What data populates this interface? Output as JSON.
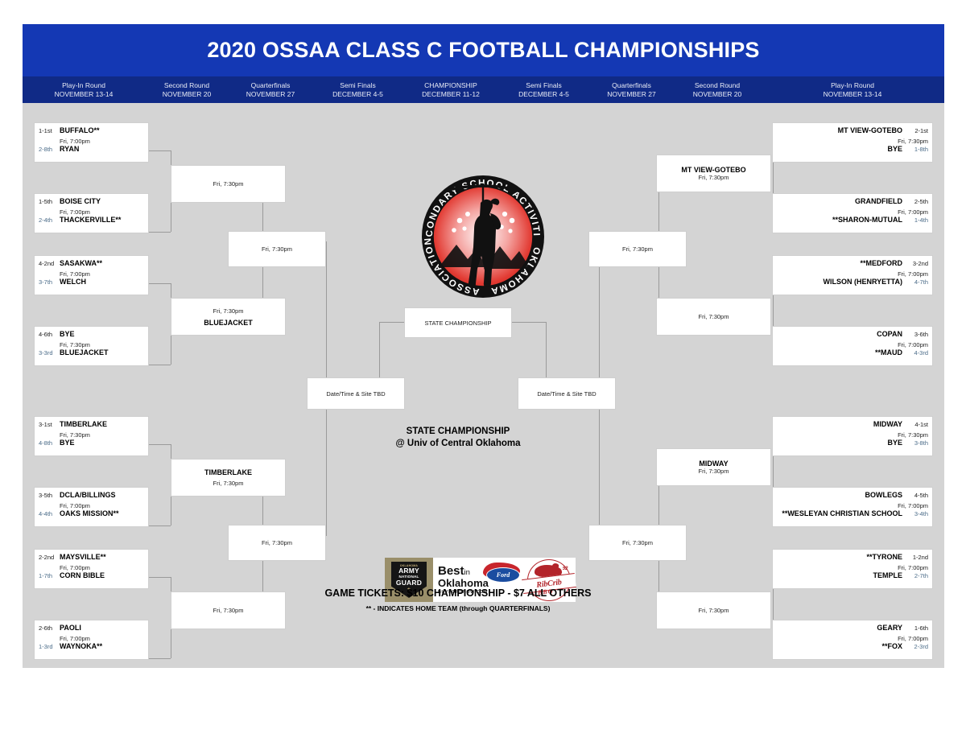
{
  "title": "2020 OSSAA CLASS C FOOTBALL CHAMPIONSHIPS",
  "colors": {
    "title_bar": "#1438b4",
    "round_bar": "#102a86",
    "panel_bg": "#d4d4d4",
    "box_bg": "#ffffff",
    "line": "#9a9a9a",
    "seed_text": "#4a6b88"
  },
  "rounds": [
    {
      "name": "Play-In Round",
      "dates": "NOVEMBER 13-14"
    },
    {
      "name": "Second Round",
      "dates": "NOVEMBER 20"
    },
    {
      "name": "Quarterfinals",
      "dates": "NOVEMBER 27"
    },
    {
      "name": "Semi Finals",
      "dates": "DECEMBER 4-5"
    },
    {
      "name": "CHAMPIONSHIP",
      "dates": "DECEMBER 11-12"
    },
    {
      "name": "Semi Finals",
      "dates": "DECEMBER 4-5"
    },
    {
      "name": "Quarterfinals",
      "dates": "NOVEMBER 27"
    },
    {
      "name": "Second Round",
      "dates": "NOVEMBER 20"
    },
    {
      "name": "Play-In Round",
      "dates": "NOVEMBER 13-14"
    }
  ],
  "left": {
    "playin": [
      {
        "seed_top": "1-1st",
        "team_top": "BUFFALO**",
        "time": "Fri, 7:00pm",
        "seed_bot": "2-8th",
        "team_bot": "RYAN"
      },
      {
        "seed_top": "1-5th",
        "team_top": "BOISE CITY",
        "time": "Fri, 7:00pm",
        "seed_bot": "2-4th",
        "team_bot": "THACKERVILLE**"
      },
      {
        "seed_top": "4-2nd",
        "team_top": "SASAKWA**",
        "time": "Fri, 7:00pm",
        "seed_bot": "3-7th",
        "team_bot": "WELCH"
      },
      {
        "seed_top": "4-6th",
        "team_top": "BYE",
        "time": "Fri, 7:30pm",
        "seed_bot": "3-3rd",
        "team_bot": "BLUEJACKET"
      },
      {
        "seed_top": "3-1st",
        "team_top": "TIMBERLAKE",
        "time": "Fri, 7:30pm",
        "seed_bot": "4-8th",
        "team_bot": "BYE"
      },
      {
        "seed_top": "3-5th",
        "team_top": "DCLA/BILLINGS",
        "time": "Fri, 7:00pm",
        "seed_bot": "4-4th",
        "team_bot": "OAKS MISSION**"
      },
      {
        "seed_top": "2-2nd",
        "team_top": "MAYSVILLE**",
        "time": "Fri, 7:00pm",
        "seed_bot": "1-7th",
        "team_bot": "CORN BIBLE"
      },
      {
        "seed_top": "2-6th",
        "team_top": "PAOLI",
        "time": "Fri, 7:00pm",
        "seed_bot": "1-3rd",
        "team_bot": "WAYNOKA**"
      }
    ],
    "second_round": [
      {
        "team": "",
        "time": "Fri, 7:30pm"
      },
      {
        "team": "BLUEJACKET",
        "time": "Fri, 7:30pm"
      },
      {
        "team": "TIMBERLAKE",
        "time": "Fri, 7:30pm"
      },
      {
        "team": "",
        "time": "Fri, 7:30pm"
      }
    ],
    "quarterfinals": [
      {
        "team": "",
        "time": "Fri, 7:30pm"
      },
      {
        "team": "",
        "time": "Fri, 7:30pm"
      }
    ],
    "semifinal": {
      "team": "",
      "time": "Date/Time & Site TBD"
    }
  },
  "right": {
    "playin": [
      {
        "seed_top": "2-1st",
        "team_top": "MT VIEW-GOTEBO",
        "time": "Fri, 7:30pm",
        "seed_bot": "1-8th",
        "team_bot": "BYE"
      },
      {
        "seed_top": "2-5th",
        "team_top": "GRANDFIELD",
        "time": "Fri, 7:00pm",
        "seed_bot": "1-4th",
        "team_bot": "**SHARON-MUTUAL"
      },
      {
        "seed_top": "3-2nd",
        "team_top": "**MEDFORD",
        "time": "Fri, 7:00pm",
        "seed_bot": "4-7th",
        "team_bot": "WILSON (HENRYETTA)"
      },
      {
        "seed_top": "3-6th",
        "team_top": "COPAN",
        "time": "Fri, 7:00pm",
        "seed_bot": "4-3rd",
        "team_bot": "**MAUD"
      },
      {
        "seed_top": "4-1st",
        "team_top": "MIDWAY",
        "time": "Fri, 7:30pm",
        "seed_bot": "3-8th",
        "team_bot": "BYE"
      },
      {
        "seed_top": "4-5th",
        "team_top": "BOWLEGS",
        "time": "Fri, 7:00pm",
        "seed_bot": "3-4th",
        "team_bot": "**WESLEYAN CHRISTIAN SCHOOL"
      },
      {
        "seed_top": "1-2nd",
        "team_top": "**TYRONE",
        "time": "Fri, 7:00pm",
        "seed_bot": "2-7th",
        "team_bot": "TEMPLE"
      },
      {
        "seed_top": "1-6th",
        "team_top": "GEARY",
        "time": "Fri, 7:00pm",
        "seed_bot": "2-3rd",
        "team_bot": "**FOX"
      }
    ],
    "second_round": [
      {
        "team": "MT VIEW-GOTEBO",
        "time": "Fri, 7:30pm"
      },
      {
        "team": "",
        "time": "Fri, 7:30pm"
      },
      {
        "team": "MIDWAY",
        "time": "Fri, 7:30pm"
      },
      {
        "team": "",
        "time": "Fri, 7:30pm"
      }
    ],
    "quarterfinals": [
      {
        "team": "",
        "time": "Fri, 7:30pm"
      },
      {
        "team": "",
        "time": "Fri, 7:30pm"
      }
    ],
    "semifinal": {
      "team": "",
      "time": "Date/Time & Site TBD"
    }
  },
  "championship": {
    "label": "STATE CHAMPIONSHIP"
  },
  "center_notes": {
    "line1": "STATE CHAMPIONSHIP",
    "line2": "@ Univ of Central Oklahoma",
    "tickets": "GAME TICKETS: $10 CHAMPIONSHIP - $7 ALL OTHERS",
    "home_team": "** - INDICATES HOME TEAM (through QUARTERFINALS)"
  },
  "logo": {
    "name": "ossaa-seal",
    "ring_text": "OKLAHOMA SECONDARY SCHOOL ACTIVITIES ASSOCIATION"
  },
  "sponsors": [
    {
      "name": "army-national-guard",
      "l0": "OKLAHOMA",
      "l1": "ARMY",
      "l2": "NATIONAL",
      "l3": "GUARD"
    },
    {
      "name": "best-in-oklahoma-ford",
      "l1": "Best",
      "l1b": "in",
      "l2": "Oklahoma",
      "l3": "BUYFORDNOW.COM",
      "oval": "Ford"
    },
    {
      "name": "rib-crib-bbq",
      "l1": "RibCrib",
      "l2": "BBQ",
      "year": "92"
    }
  ]
}
